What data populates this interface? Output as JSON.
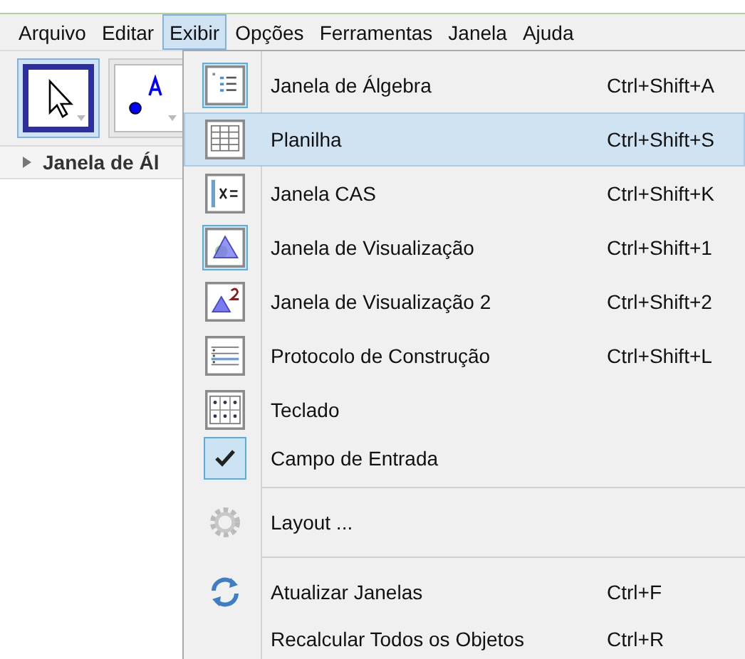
{
  "menubar": [
    {
      "label": "Arquivo",
      "selected": false
    },
    {
      "label": "Editar",
      "selected": false
    },
    {
      "label": "Exibir",
      "selected": true
    },
    {
      "label": "Opções",
      "selected": false
    },
    {
      "label": "Ferramentas",
      "selected": false
    },
    {
      "label": "Janela",
      "selected": false
    },
    {
      "label": "Ajuda",
      "selected": false
    }
  ],
  "toolbar": [
    {
      "selected": true
    },
    {
      "selected": false
    }
  ],
  "panel_header": {
    "label": "Janela de Ál"
  },
  "menu": {
    "groups": [
      {
        "items": [
          {
            "kind": "view",
            "label": "Janela de Álgebra",
            "shortcut": "Ctrl+Shift+A",
            "checked": true,
            "selected": false
          },
          {
            "kind": "view",
            "label": "Planilha",
            "shortcut": "Ctrl+Shift+S",
            "checked": false,
            "selected": true
          },
          {
            "kind": "view",
            "label": "Janela CAS",
            "shortcut": "Ctrl+Shift+K",
            "checked": false,
            "selected": false
          },
          {
            "kind": "view",
            "label": "Janela de Visualização",
            "shortcut": "Ctrl+Shift+1",
            "checked": true,
            "selected": false
          },
          {
            "kind": "view",
            "label": "Janela de Visualização 2",
            "shortcut": "Ctrl+Shift+2",
            "checked": false,
            "selected": false
          },
          {
            "kind": "view",
            "label": "Protocolo de Construção",
            "shortcut": "Ctrl+Shift+L",
            "checked": false,
            "selected": false
          },
          {
            "kind": "view",
            "label": "Teclado",
            "checked": false,
            "selected": false
          },
          {
            "kind": "check",
            "label": "Campo de Entrada",
            "checked": true,
            "selected": false
          }
        ]
      },
      {
        "items": [
          {
            "kind": "action",
            "label": "Layout ...",
            "selected": false
          }
        ]
      },
      {
        "items": [
          {
            "kind": "action",
            "label": "Atualizar Janelas",
            "shortcut": "Ctrl+F",
            "selected": false
          },
          {
            "kind": "action",
            "label": "Recalcular Todos os Objetos",
            "shortcut": "Ctrl+R",
            "selected": false
          }
        ]
      }
    ]
  }
}
